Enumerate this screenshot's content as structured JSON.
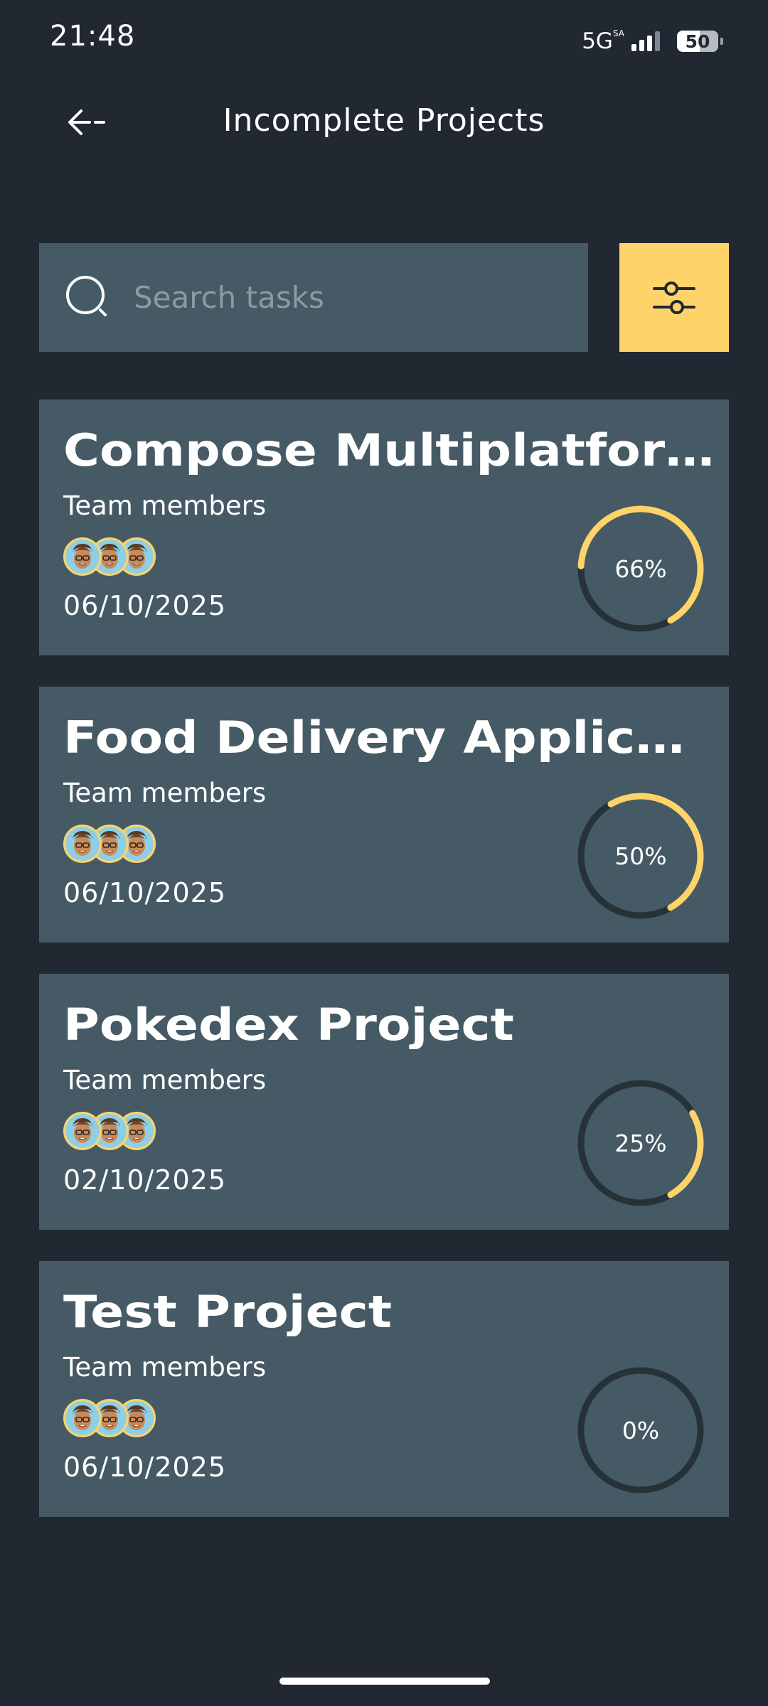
{
  "status_bar": {
    "time": "21:48",
    "network": "5G",
    "network_sup": "SA",
    "battery": "50"
  },
  "header": {
    "title": "Incomplete Projects",
    "back_icon": "arrow-left-icon"
  },
  "search": {
    "placeholder": "Search tasks",
    "value": "",
    "icon": "search-icon"
  },
  "filter": {
    "icon": "sliders-icon"
  },
  "projects": [
    {
      "title": "Compose Multiplatform",
      "team_label": "Team members",
      "date": "06/10/2025",
      "progress": 0.66,
      "progress_label": "66%"
    },
    {
      "title": "Food Delivery Application",
      "team_label": "Team members",
      "date": "06/10/2025",
      "progress": 0.5,
      "progress_label": "50%"
    },
    {
      "title": "Pokedex Project",
      "team_label": "Team members",
      "date": "02/10/2025",
      "progress": 0.25,
      "progress_label": "25%"
    },
    {
      "title": "Test Project",
      "team_label": "Team members",
      "date": "06/10/2025",
      "progress": 0.0,
      "progress_label": "0%"
    }
  ],
  "colors": {
    "background": "#212832",
    "card": "#455A64",
    "accent": "#FED36A",
    "ring_track": "#263238",
    "placeholder": "#8C9BA3"
  }
}
